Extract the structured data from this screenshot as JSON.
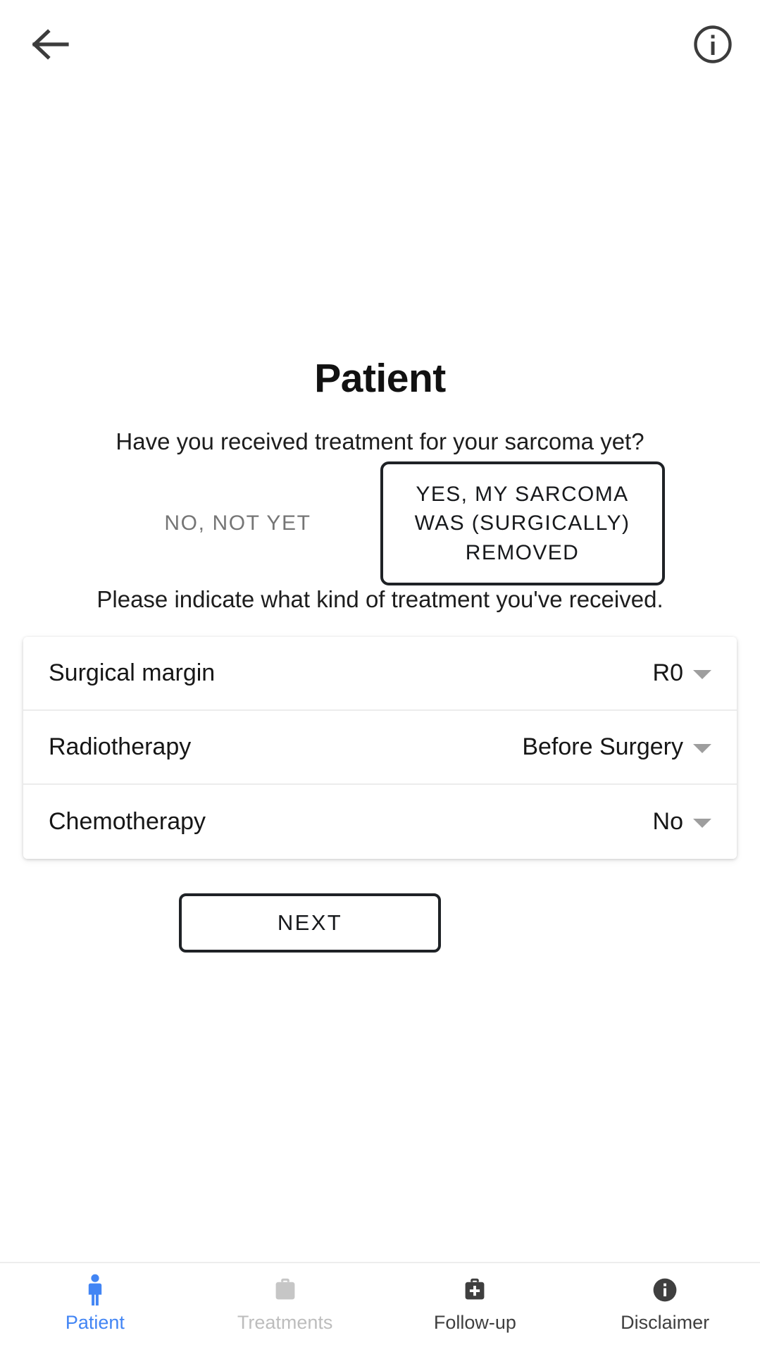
{
  "header": {
    "back_icon": "arrow-left-icon",
    "info_icon": "info-circle-icon"
  },
  "main": {
    "title": "Patient",
    "question": "Have you received treatment for your sarcoma yet?",
    "options": [
      {
        "label": "NO, NOT YET",
        "selected": false
      },
      {
        "label": "YES, MY SARCOMA WAS (SURGICALLY) REMOVED",
        "selected": true
      }
    ],
    "subinstruction": "Please indicate what kind of treatment you've received.",
    "fields": [
      {
        "label": "Surgical margin",
        "value": "R0",
        "caret": "chevron-down-icon"
      },
      {
        "label": "Radiotherapy",
        "value": "Before Surgery",
        "caret": "chevron-down-icon"
      },
      {
        "label": "Chemotherapy",
        "value": "No",
        "caret": "chevron-down-icon"
      }
    ],
    "next_label": "NEXT"
  },
  "bottom_nav": {
    "items": [
      {
        "label": "Patient",
        "icon": "person-icon",
        "active": true,
        "color": "#4285f4"
      },
      {
        "label": "Treatments",
        "icon": "briefcase-icon",
        "active": false,
        "color": "#bdbdbd"
      },
      {
        "label": "Follow-up",
        "icon": "medical-bag-icon",
        "active": false,
        "color": "#3f3f3f"
      },
      {
        "label": "Disclaimer",
        "icon": "info-filled-icon",
        "active": false,
        "color": "#3f3f3f"
      }
    ]
  },
  "colors": {
    "accent_blue": "#4285f4",
    "disabled_gray": "#bdbdbd",
    "icon_dark": "#3f3f3f",
    "text_primary": "#161616",
    "muted_text": "#757575"
  }
}
